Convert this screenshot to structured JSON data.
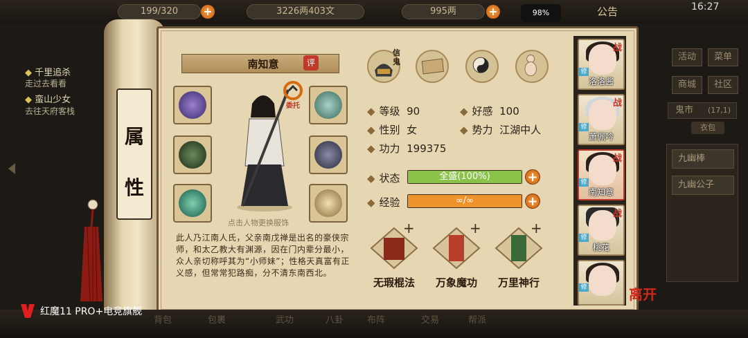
{
  "topbar": {
    "res1": "199/320",
    "res2": "3226两403文",
    "res3": "995两",
    "battery": "98%",
    "announce": "公告",
    "time": "16:27"
  },
  "quests": [
    {
      "title": "千里追杀",
      "sub": "走过去看看"
    },
    {
      "title": "蛮山少女",
      "sub": "去往天府客栈"
    }
  ],
  "scroll_title": [
    "属",
    "性"
  ],
  "character": {
    "name": "南知意",
    "ping_label": "评",
    "tap_hint": "点击人物更换服饰",
    "weituo_label": "委托",
    "bio": "此人乃江南人氏，父亲南戊禅是出名的豪侠宗师，和太乙教大有渊源，因在门内辈分最小，众人亲切称呼其为“小师妹”；性格天真富有正义感，但常常犯路痴，分不清东南西北。"
  },
  "top_icons": {
    "badge": "信鬼"
  },
  "stats": {
    "level_label": "等级",
    "level": "90",
    "favor_label": "好感",
    "favor": "100",
    "gender_label": "性别",
    "gender": "女",
    "faction_label": "势力",
    "faction": "江湖中人",
    "power_label": "功力",
    "power": "199375",
    "state_label": "状态",
    "state_text": "全盛(100%)",
    "state_fraction": 1.0,
    "exp_label": "经验",
    "exp_text": "∞/∞",
    "exp_fraction": 1.0
  },
  "skills": [
    {
      "name": "无瑕棍法"
    },
    {
      "name": "万象魔功"
    },
    {
      "name": "万里神行"
    }
  ],
  "party": [
    {
      "name": "洛洛酱",
      "zhan": "战",
      "xiu": "修"
    },
    {
      "name": "萧佩吟",
      "zhan": "战",
      "xiu": "修"
    },
    {
      "name": "南知意",
      "zhan": "战",
      "xiu": "修"
    },
    {
      "name": "桃花",
      "zhan": "战",
      "xiu": "修"
    },
    {
      "name": "",
      "zhan": "",
      "xiu": "修"
    }
  ],
  "leave_label": "离开",
  "right_menu": {
    "activity": "活动",
    "menu": "菜单",
    "shop": "商城",
    "community": "社区",
    "ghost_market": "鬼市",
    "ghost_coord": "(17,1)",
    "bag": "衣包",
    "items": [
      "九幽棒",
      "九幽公子"
    ]
  },
  "bottom_tabs": [
    "背包",
    "包裹",
    "武功",
    "八卦",
    "布阵",
    "交易",
    "帮派"
  ],
  "device_brand": "红魔11 PRO+电竞旗舰",
  "colors": {
    "state_bar": "#8bc34a",
    "exp_bar": "#f0922a",
    "accent_red": "#c0392b"
  }
}
